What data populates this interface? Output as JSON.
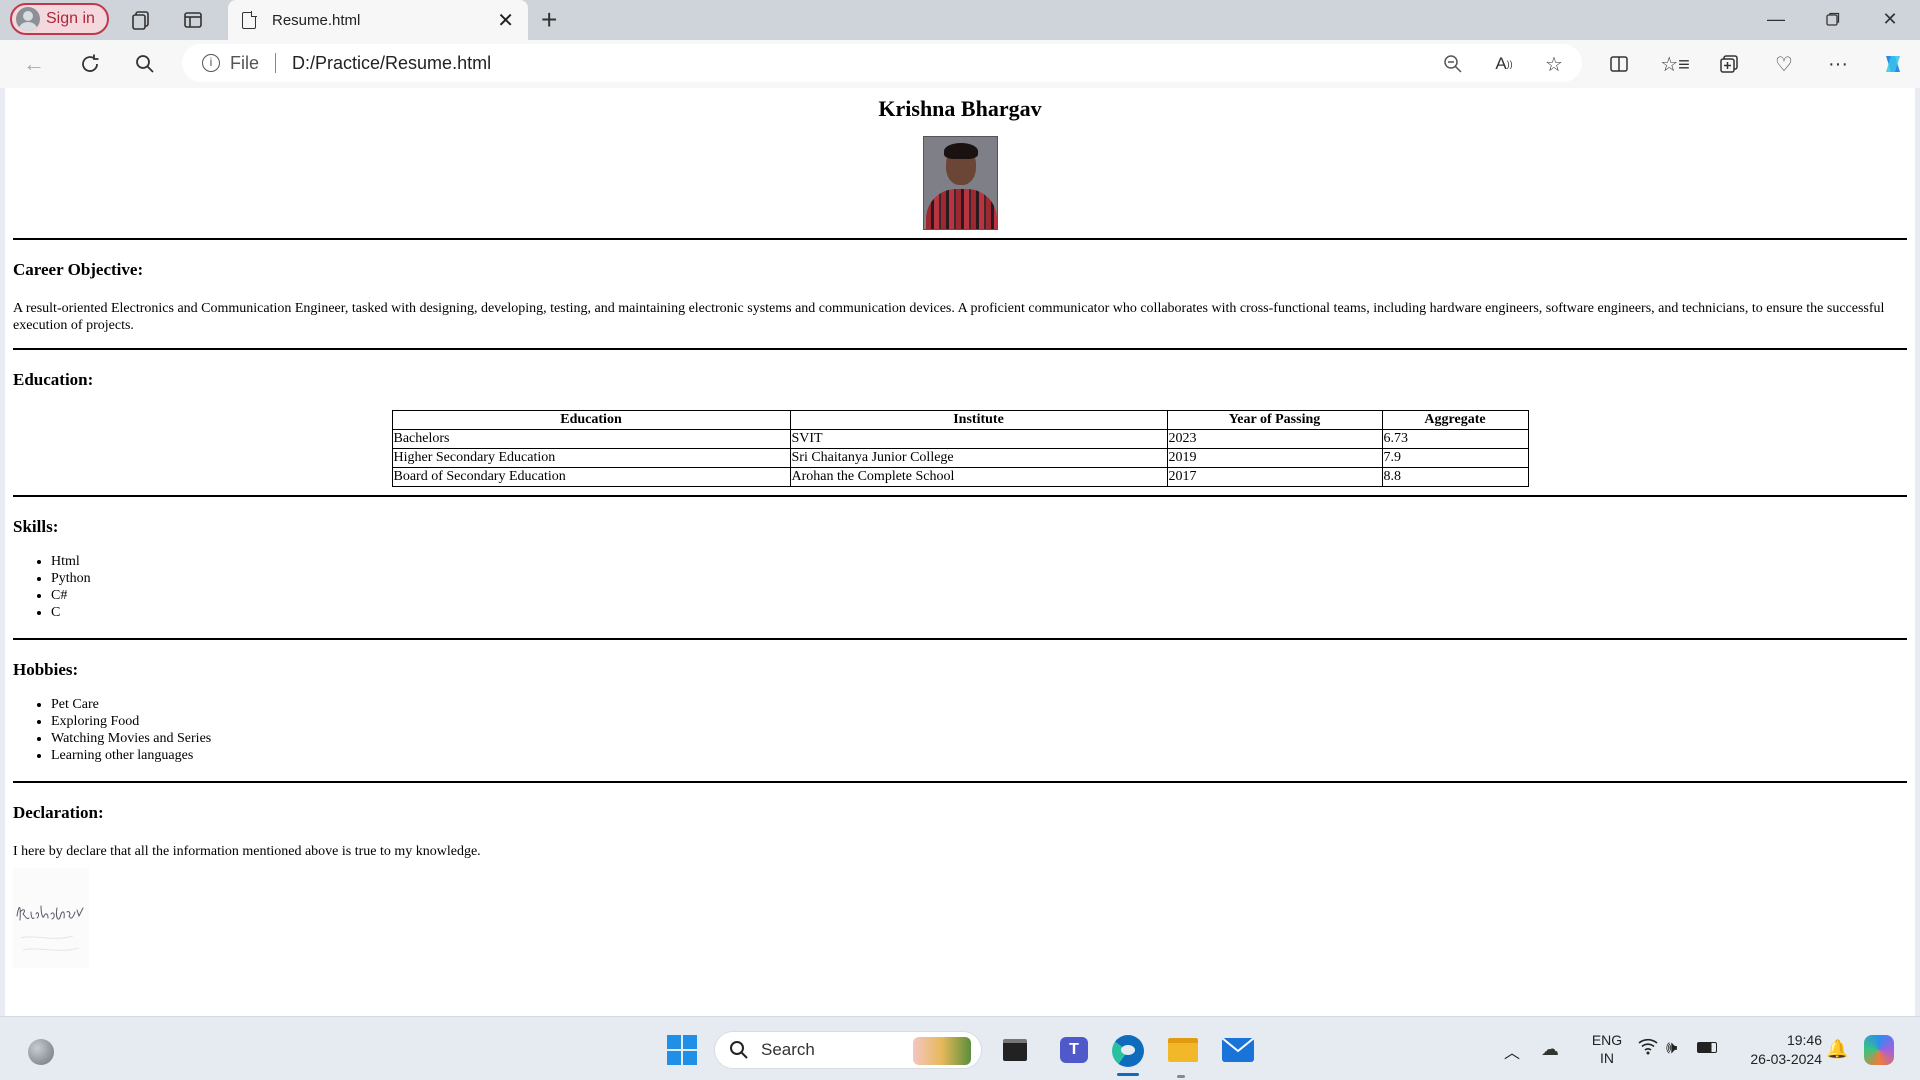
{
  "browser": {
    "sign_in": "Sign in",
    "tab_title": "Resume.html",
    "address_label": "File",
    "url": "D:/Practice/Resume.html"
  },
  "resume": {
    "name": "Krishna Bhargav",
    "career_heading": "Career Objective:",
    "career_text": "A result-oriented Electronics and Communication Engineer, tasked with designing, developing, testing, and maintaining electronic systems and communication devices. A proficient communicator who collaborates with cross-functional teams, including hardware engineers, software engineers, and technicians, to ensure the successful execution of projects.",
    "education_heading": "Education:",
    "education_table": {
      "headers": [
        "Education",
        "Institute",
        "Year of Passing",
        "Aggregate"
      ],
      "rows": [
        [
          "Bachelors",
          "SVIT",
          "2023",
          "6.73"
        ],
        [
          "Higher Secondary Education",
          "Sri Chaitanya Junior College",
          "2019",
          "7.9"
        ],
        [
          "Board of Secondary Education",
          "Arohan the Complete School",
          "2017",
          "8.8"
        ]
      ]
    },
    "skills_heading": "Skills:",
    "skills": [
      "Html",
      "Python",
      "C#",
      "C"
    ],
    "hobbies_heading": "Hobbies:",
    "hobbies": [
      "Pet Care",
      "Exploring Food",
      "Watching Movies and Series",
      "Learning other languages"
    ],
    "declaration_heading": "Declaration:",
    "declaration_text": "I here by declare that all the information mentioned above is true to my knowledge.",
    "signature_text": "Krishna Bhargav"
  },
  "taskbar": {
    "search_placeholder": "Search",
    "lang_1": "ENG",
    "lang_2": "IN",
    "time": "19:46",
    "date": "26-03-2024"
  },
  "colors": {
    "signin_border": "#c0384b",
    "taskbar_bg": "#e6ebf2",
    "edge_blue": "#0f6cbd"
  }
}
